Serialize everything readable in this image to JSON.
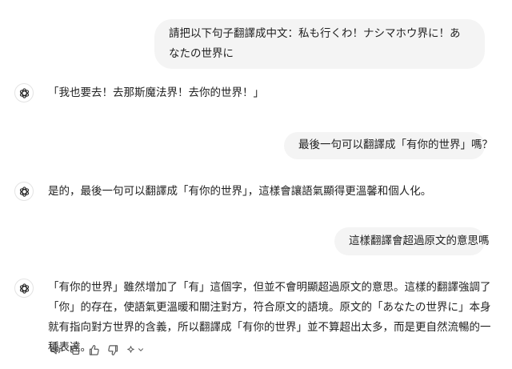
{
  "conversation": {
    "user_1": "請把以下句子翻譯成中文：私も行くわ！ナシマホウ界に！あなたの世界に",
    "assistant_1": "「我也要去！去那斯魔法界！去你的世界！」",
    "user_2": "最後一句可以翻譯成「有你的世界」嗎？",
    "assistant_2": "是的，最後一句可以翻譯成「有你的世界」，這樣會讓語氣顯得更溫馨和個人化。",
    "user_3": "這樣翻譯會超過原文的意思嗎",
    "assistant_3": "「有你的世界」雖然增加了「有」這個字，但並不會明顯超過原文的意思。這樣的翻譯強調了「你」的存在，使語氣更溫暖和關注對方，符合原文的語境。原文的「あなたの世界に」本身就有指向對方世界的含義，所以翻譯成「有你的世界」並不算超出太多，而是更自然流暢的一種表達。"
  },
  "icons": {
    "assistant_avatar": "openai-logo-icon",
    "read_aloud": "speaker-icon",
    "copy": "copy-icon",
    "good_response": "thumbs-up-icon",
    "bad_response": "thumbs-down-icon",
    "switch_model": "sparkle-icon",
    "dropdown": "chevron-down-icon"
  },
  "colors": {
    "user_bubble": "#f4f4f4",
    "text": "#1f1f1f",
    "icon": "#5d5d5d"
  }
}
